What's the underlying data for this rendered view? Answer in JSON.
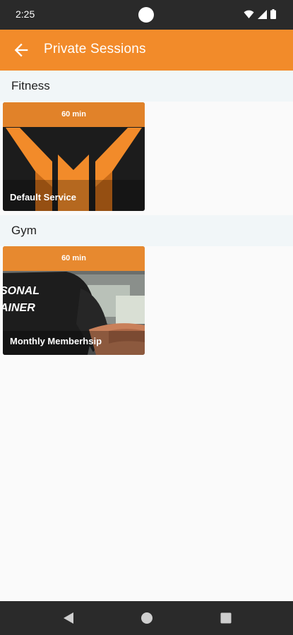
{
  "status_bar": {
    "time": "2:25"
  },
  "app_bar": {
    "title": "Private Sessions"
  },
  "sections": [
    {
      "title": "Fitness",
      "cards": [
        {
          "duration": "60 min",
          "name": "Default Service"
        }
      ]
    },
    {
      "title": "Gym",
      "cards": [
        {
          "duration": "60 min",
          "name": "Monthly Memberhsip"
        }
      ]
    }
  ],
  "card_image_text": {
    "line1": "SONAL",
    "line2": "AINER"
  },
  "colors": {
    "accent": "#f28b2a",
    "system_bar": "#2a2a2a",
    "section_bg": "#f1f6f8"
  },
  "icons": [
    "wifi-icon",
    "signal-icon",
    "battery-icon",
    "back-arrow-icon",
    "nav-back-icon",
    "nav-home-icon",
    "nav-recents-icon"
  ]
}
